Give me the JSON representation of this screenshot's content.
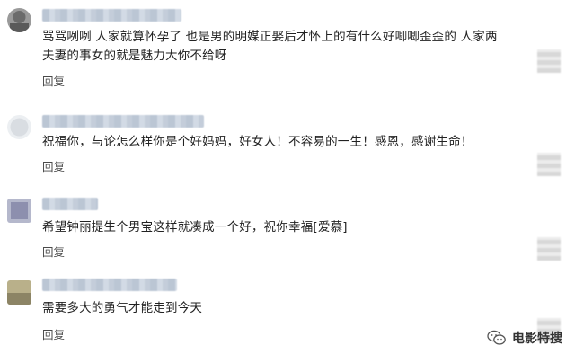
{
  "comments": [
    {
      "text": "骂骂咧咧 人家就算怀孕了 也是男的明媒正娶后才怀上的有什么好唧唧歪歪的 人家两夫妻的事女的就是魅力大你不给呀",
      "reply_label": "回复",
      "avatar_colors": [
        "#6b6b6b",
        "#9a9a9a"
      ]
    },
    {
      "text": "祝福你，与论怎么样你是个好妈妈，好女人！不容易的一生！感恩，感谢生命！",
      "reply_label": "回复",
      "avatar_colors": [
        "#d9dde2",
        "#eceff2"
      ]
    },
    {
      "text": "希望钟丽提生个男宝这样就凑成一个好，祝你幸福[爱慕]",
      "reply_label": "回复",
      "avatar_colors": [
        "#8d8fae",
        "#b5b8cc"
      ]
    },
    {
      "text": "需要多大的勇气才能走到今天",
      "reply_label": "回复",
      "avatar_colors": [
        "#8c8465",
        "#b9b08a"
      ]
    }
  ],
  "watermark": {
    "text": "电影特搜",
    "icon": "wechat-icon"
  }
}
